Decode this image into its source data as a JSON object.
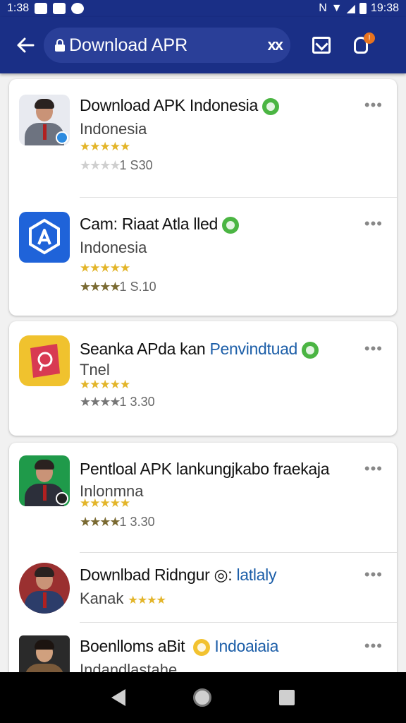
{
  "status": {
    "time_left": "1:38",
    "time_right": "19:38",
    "network": "N"
  },
  "app_bar": {
    "search_text": "Download APR",
    "clear_label": "xx"
  },
  "results": [
    {
      "title": "Download APK Indonesia",
      "subtitle": "Indonesia",
      "stars": "★★★★★",
      "rating_stars": "★★★★",
      "rating_text": "1 S30",
      "more": "•••"
    },
    {
      "title": "Cam: Riaat Atla lled",
      "subtitle": "Indonesia",
      "stars": "★★★★★",
      "rating_stars": "★★★★",
      "rating_text": "1 S.10",
      "more": "•••"
    },
    {
      "title": "Seanka APda kan",
      "title_accent": "Penvindtuad",
      "subtitle": "Tnel",
      "stars": "★★★★★",
      "rating_stars": "★★★★",
      "rating_text": "1 3.30",
      "more": "•••"
    },
    {
      "title": "Pentloal APK lankungjkabo fraekaja",
      "subtitle": "Inlonmna",
      "stars": "★★★★★",
      "rating_stars": "★★★★",
      "rating_text": "1 3.30",
      "more": "•••"
    },
    {
      "title": "Downlbad Ridngur",
      "title_accent": "latlaly",
      "subtitle": "Kanak",
      "stars": "★★★★",
      "more": "•••"
    },
    {
      "title": "Boenlloms aBit",
      "title_accent": "Indoaiaia",
      "subtitle": "Indandlastahe",
      "more": "•••"
    }
  ],
  "colors": {
    "app_bar": "#1a2f86",
    "accent_link": "#1c5ea8",
    "star_gold": "#e3b52a",
    "badge_green": "#4bb543"
  },
  "icons": [
    "back-arrow-icon",
    "lock-icon",
    "clear-icon",
    "mail-icon",
    "lightbulb-icon",
    "more-icon",
    "verified-badge-icon"
  ]
}
